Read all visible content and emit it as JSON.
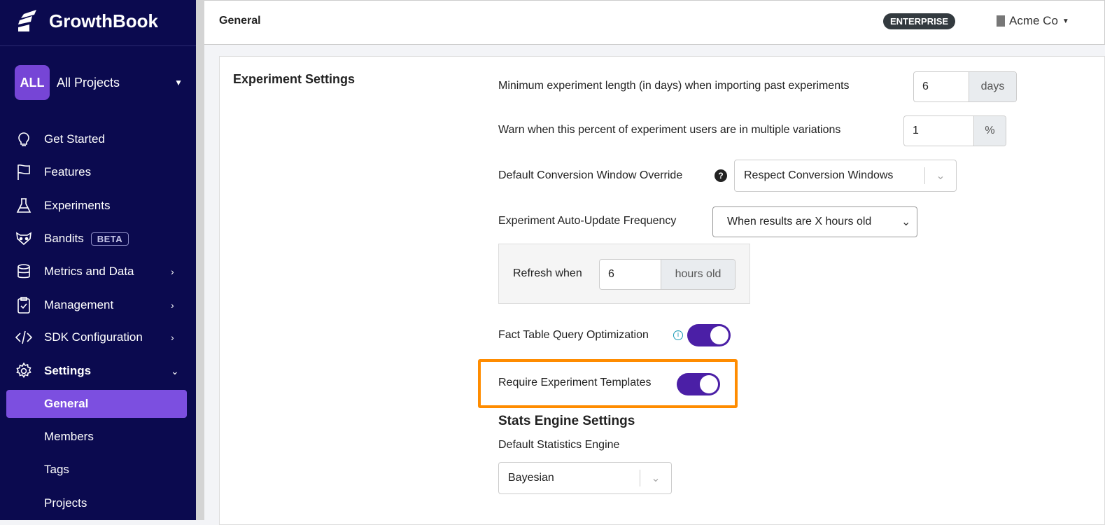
{
  "app": {
    "name": "GrowthBook"
  },
  "project": {
    "badge": "ALL",
    "name": "All Projects"
  },
  "sidebar": {
    "items": [
      {
        "label": "Get Started",
        "icon": "lightbulb-icon"
      },
      {
        "label": "Features",
        "icon": "flag-icon"
      },
      {
        "label": "Experiments",
        "icon": "flask-icon"
      },
      {
        "label": "Bandits",
        "icon": "raccoon-icon",
        "badge": "BETA"
      },
      {
        "label": "Metrics and Data",
        "icon": "database-icon"
      },
      {
        "label": "Management",
        "icon": "clipboard-icon"
      },
      {
        "label": "SDK Configuration",
        "icon": "code-icon"
      },
      {
        "label": "Settings",
        "icon": "gear-icon"
      }
    ],
    "sub_items": [
      {
        "label": "General",
        "active": true
      },
      {
        "label": "Members"
      },
      {
        "label": "Tags"
      },
      {
        "label": "Projects"
      }
    ]
  },
  "header": {
    "title": "General",
    "plan_badge": "ENTERPRISE",
    "org": "Acme Co"
  },
  "experiment_settings": {
    "title": "Experiment Settings",
    "min_length": {
      "label": "Minimum experiment length (in days) when importing past experiments",
      "value": "6",
      "unit": "days"
    },
    "multiple_exposure": {
      "label": "Warn when this percent of experiment users are in multiple variations",
      "value": "1",
      "unit": "%"
    },
    "conversion_window": {
      "label": "Default Conversion Window Override",
      "value": "Respect Conversion Windows"
    },
    "auto_update": {
      "label": "Experiment Auto-Update Frequency",
      "value": "When results are X hours old"
    },
    "refresh": {
      "label": "Refresh when",
      "value": "6",
      "unit": "hours old"
    },
    "fact_table": {
      "label": "Fact Table Query Optimization",
      "enabled": true
    },
    "require_templates": {
      "label": "Require Experiment Templates",
      "enabled": true
    }
  },
  "stats_engine": {
    "title": "Stats Engine Settings",
    "label": "Default Statistics Engine",
    "value": "Bayesian"
  },
  "colors": {
    "sidebar": "#0b0a4f",
    "accent": "#7c4fe0",
    "toggle": "#4b1fa6",
    "highlight": "#ff8c00"
  }
}
